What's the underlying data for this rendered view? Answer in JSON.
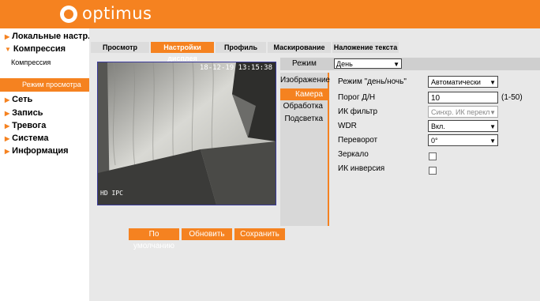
{
  "brand": {
    "name": "optimus",
    "color": "#f58220"
  },
  "sidebar": {
    "items": [
      {
        "label": "Локальные настр.",
        "expanded": false
      },
      {
        "label": "Компрессия",
        "expanded": true,
        "children": [
          "Компрессия",
          "Режим просмотра"
        ],
        "active_child": "Режим просмотра"
      },
      {
        "label": "Сеть",
        "expanded": false
      },
      {
        "label": "Запись",
        "expanded": false
      },
      {
        "label": "Тревога",
        "expanded": false
      },
      {
        "label": "Система",
        "expanded": false
      },
      {
        "label": "Информация",
        "expanded": false
      }
    ]
  },
  "tabs": [
    {
      "label": "Просмотр",
      "active": false
    },
    {
      "label": "Настройки дисплея",
      "active": true
    },
    {
      "label": "Профиль",
      "active": false
    },
    {
      "label": "Маскирование",
      "active": false
    },
    {
      "label": "Наложение текста",
      "active": false
    }
  ],
  "video": {
    "timestamp": "18-12-19 13:15:38",
    "osd": "HD IPC"
  },
  "mode": {
    "label": "Режим",
    "value": "День"
  },
  "subtabs": [
    {
      "label": "Изображение",
      "active": false
    },
    {
      "label": "Камера",
      "active": true
    },
    {
      "label": "Обработка",
      "active": false
    },
    {
      "label": "Подсветка",
      "active": false
    }
  ],
  "fields": {
    "daynight": {
      "label": "Режим \"день/ночь\"",
      "value": "Автоматически"
    },
    "threshold": {
      "label": "Порог Д/Н",
      "value": "10",
      "hint": "(1-50)"
    },
    "ircut": {
      "label": "ИК фильтр",
      "value": "Синхр. ИК перекл"
    },
    "wdr": {
      "label": "WDR",
      "value": "Вкл."
    },
    "flip": {
      "label": "Переворот",
      "value": "0°"
    },
    "mirror": {
      "label": "Зеркало",
      "checked": false
    },
    "irinvert": {
      "label": "ИК инверсия",
      "checked": false
    }
  },
  "buttons": {
    "default": "По умолчанию",
    "refresh": "Обновить",
    "save": "Сохранить"
  }
}
